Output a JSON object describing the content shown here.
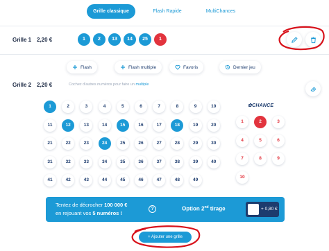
{
  "tabs": [
    {
      "label": "Grille classique",
      "active": true
    },
    {
      "label": "Flash Rapide",
      "active": false
    },
    {
      "label": "MultiChances",
      "active": false
    }
  ],
  "grid1": {
    "label": "Grille 1",
    "price": "2,20 €",
    "numbers": [
      "1",
      "2",
      "13",
      "14",
      "25"
    ],
    "chance": "1"
  },
  "quick_picks": [
    {
      "label": "Flash",
      "icon": "plus-icon"
    },
    {
      "label": "Flash multiple",
      "icon": "plus-icon"
    },
    {
      "label": "Favoris",
      "icon": "heart-icon"
    },
    {
      "label": "Dernier jeu",
      "icon": "history-icon"
    }
  ],
  "grid2": {
    "label": "Grille 2",
    "price": "2,20 €",
    "hint_prefix": "Cochez d'autres numéros pour faire un",
    "hint_link": "multiple",
    "numbers": [
      "1",
      "2",
      "3",
      "4",
      "5",
      "6",
      "7",
      "8",
      "9",
      "10",
      "11",
      "12",
      "13",
      "14",
      "15",
      "16",
      "17",
      "18",
      "19",
      "20",
      "21",
      "22",
      "23",
      "24",
      "25",
      "26",
      "27",
      "28",
      "29",
      "30",
      "31",
      "32",
      "33",
      "34",
      "35",
      "36",
      "37",
      "38",
      "39",
      "40",
      "41",
      "42",
      "43",
      "44",
      "45",
      "46",
      "47",
      "48",
      "49"
    ],
    "selected": [
      "1",
      "12",
      "15",
      "18",
      "24"
    ],
    "chance_title": "CHANCE",
    "chance_numbers": [
      "1",
      "2",
      "3",
      "4",
      "5",
      "6",
      "7",
      "8",
      "9",
      "10"
    ],
    "chance_selected": [
      "2"
    ]
  },
  "banner": {
    "line1_prefix": "Tentez de décrocher",
    "line1_amount": "100 000 €",
    "line2_prefix": "en rejouant vos",
    "line2_bold": "5 numéros !",
    "info": "?",
    "option_label": "Option 2",
    "option_sup": "nd",
    "option_suffix": "tirage",
    "option_price": "+ 0,80 €"
  },
  "add_grid": "+ Ajouter une grille",
  "colors": {
    "primary": "#1c9ad6",
    "chance": "#e2343e",
    "navy": "#1d3c6e",
    "annotation": "#d8121b"
  }
}
